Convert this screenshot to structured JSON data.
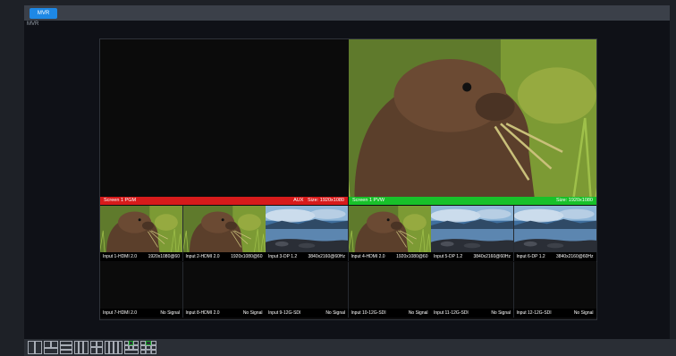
{
  "tab": {
    "label": "MVR"
  },
  "panel": {
    "label": "MVR"
  },
  "program": {
    "label": "Screen 1 PGM",
    "aux": "AUX",
    "size": "Size: 1920x1080"
  },
  "preview": {
    "label": "Screen 1 PVW",
    "size": "Size: 1920x1080"
  },
  "inputs": [
    {
      "name": "Input 1-HDMI 2.0",
      "status": "1920x1080@60",
      "thumb": "marmot"
    },
    {
      "name": "Input 2-HDMI 2.0",
      "status": "1920x1080@60",
      "thumb": "marmot"
    },
    {
      "name": "Input 3-DP 1.2",
      "status": "3840x2160@60Hz",
      "thumb": "lake"
    },
    {
      "name": "Input 4-HDMI 2.0",
      "status": "1920x1080@60",
      "thumb": "marmot"
    },
    {
      "name": "Input 5-DP 1.2",
      "status": "3840x2160@60Hz",
      "thumb": "lake"
    },
    {
      "name": "Input 6-DP 1.2",
      "status": "3840x2160@60Hz",
      "thumb": "lake"
    },
    {
      "name": "Input 7-HDMI 2.0",
      "status": "No Signal",
      "thumb": "none"
    },
    {
      "name": "Input 8-HDMI 2.0",
      "status": "No Signal",
      "thumb": "none"
    },
    {
      "name": "Input 9-12G-SDI",
      "status": "No Signal",
      "thumb": "none"
    },
    {
      "name": "Input 10-12G-SDI",
      "status": "No Signal",
      "thumb": "none"
    },
    {
      "name": "Input 11-12G-SDI",
      "status": "No Signal",
      "thumb": "none"
    },
    {
      "name": "Input 12-12G-SDI",
      "status": "No Signal",
      "thumb": "none"
    }
  ],
  "layouts": [
    "layout-1",
    "layout-2",
    "layout-3",
    "layout-4",
    "layout-5",
    "layout-6",
    "layout-7",
    "layout-8"
  ]
}
